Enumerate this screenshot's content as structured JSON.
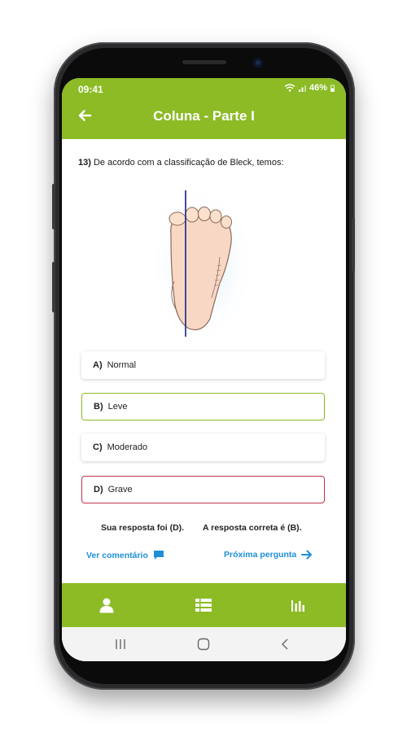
{
  "status": {
    "time": "09:41",
    "battery": "46%"
  },
  "header": {
    "title": "Coluna - Parte I"
  },
  "question": {
    "number": "13)",
    "text": "De acordo com a classificação de Bleck, temos:"
  },
  "options": [
    {
      "letter": "A)",
      "label": "Normal",
      "state": "default"
    },
    {
      "letter": "B)",
      "label": "Leve",
      "state": "correct"
    },
    {
      "letter": "C)",
      "label": "Moderado",
      "state": "default"
    },
    {
      "letter": "D)",
      "label": "Grave",
      "state": "wrong"
    }
  ],
  "result": {
    "your_answer": "Sua resposta foi (D).",
    "correct_answer": "A resposta correta é (B)."
  },
  "actions": {
    "comment_label": "Ver comentário",
    "next_label": "Próxima pergunta"
  },
  "bottom_nav": {
    "items": [
      "person-icon",
      "list-icon",
      "stats-icon"
    ]
  },
  "colors": {
    "primary": "#8cbb26",
    "link": "#1e8fd6",
    "correct": "#8cbb26",
    "wrong": "#c0334a"
  }
}
